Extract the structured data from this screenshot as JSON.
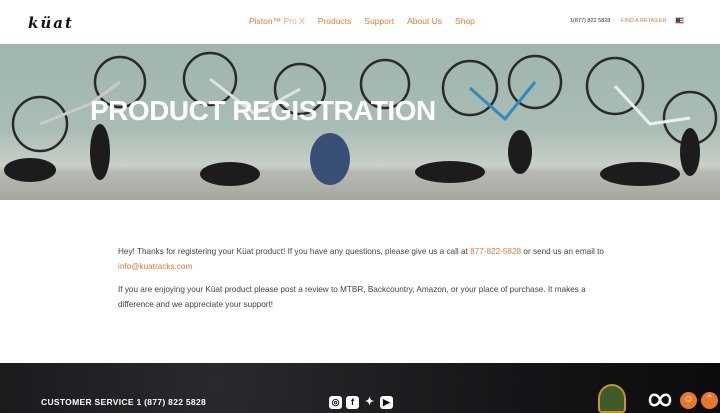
{
  "header": {
    "logo": "küat",
    "nav": [
      {
        "label": "Piston™",
        "sub": " Pro X"
      },
      {
        "label": "Products"
      },
      {
        "label": "Support"
      },
      {
        "label": "About Us"
      },
      {
        "label": "Shop"
      }
    ],
    "phone": "1(877) 822 5828",
    "retailer": "FIND A RETAILER"
  },
  "hero": {
    "title": "PRODUCT REGISTRATION"
  },
  "content": {
    "p1_text": "Hey! Thanks for registering your Küat product! If you have any questions, please give us a call at ",
    "p1_phone": "877-822-5828",
    "p1_mid": " or send us an email to ",
    "p1_email": "info@kuatracks.com",
    "p2_text": "If you are enjoying your Küat product please post a review to MTBR, Backcountry, Amazon, or your place of purchase. It makes a difference and we appreciate your support!"
  },
  "footer": {
    "customer_service": "CUSTOMER SERVICE 1 (877) 822 5828",
    "social_icons": [
      "instagram-icon",
      "facebook-icon",
      "twitter-icon",
      "youtube-icon"
    ],
    "accent_color": "#e8772a"
  }
}
